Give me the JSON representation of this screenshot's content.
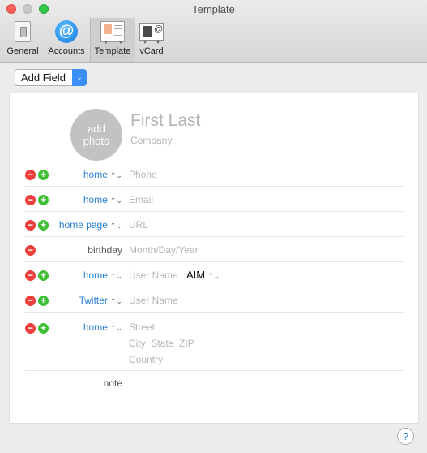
{
  "window": {
    "title": "Template"
  },
  "toolbar": {
    "items": [
      {
        "label": "General",
        "icon": "general-switch-icon"
      },
      {
        "label": "Accounts",
        "icon": "at-sign-icon"
      },
      {
        "label": "Template",
        "icon": "template-card-icon"
      },
      {
        "label": "vCard",
        "icon": "vcard-icon"
      }
    ],
    "active": "Template",
    "vcard_at": "@"
  },
  "add_field": {
    "label": "Add Field",
    "arrow": "⌄"
  },
  "card": {
    "photo_line1": "add",
    "photo_line2": "photo",
    "name": "First Last",
    "company": "Company",
    "rows": [
      {
        "label": "home",
        "placeholder": "Phone"
      },
      {
        "label": "home",
        "placeholder": "Email"
      },
      {
        "label": "home page",
        "placeholder": "URL"
      },
      {
        "label": "birthday",
        "placeholder": "Month/Day/Year"
      },
      {
        "label": "home",
        "placeholder": "User Name",
        "service": "AIM"
      },
      {
        "label": "Twitter",
        "placeholder": "User Name"
      },
      {
        "label": "home",
        "address_lines": [
          "Street",
          "City  State  ZIP",
          "Country"
        ]
      },
      {
        "label": "note"
      }
    ]
  },
  "help": {
    "label": "?"
  },
  "colors": {
    "accent": "#2a7fd4",
    "remove": "#ee3f3c",
    "add": "#3fbf35"
  }
}
